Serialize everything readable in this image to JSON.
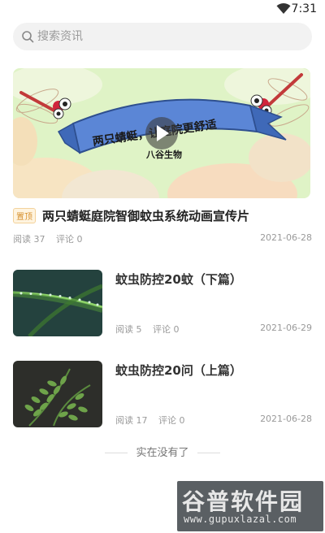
{
  "status": {
    "time": "7:31"
  },
  "search": {
    "placeholder": "搜索资讯"
  },
  "featured": {
    "banner_text": "两只蜻蜓，让庭院更舒适",
    "brand": "八谷生物",
    "badge": "置顶",
    "title": "两只蜻蜓庭院智御蚊虫系统动画宣传片",
    "reads": "阅读 37",
    "comments": "评论 0",
    "date": "2021-06-28"
  },
  "articles": [
    {
      "title": "蚊虫防控20蚊（下篇）",
      "reads": "阅读 5",
      "comments": "评论 0",
      "date": "2021-06-29"
    },
    {
      "title": "蚊虫防控20问（上篇）",
      "reads": "阅读 17",
      "comments": "评论 0",
      "date": "2021-06-28"
    }
  ],
  "end_text": "实在没有了",
  "watermark": {
    "name": "谷普软件园",
    "url": "www.gupuxlazal.com"
  }
}
